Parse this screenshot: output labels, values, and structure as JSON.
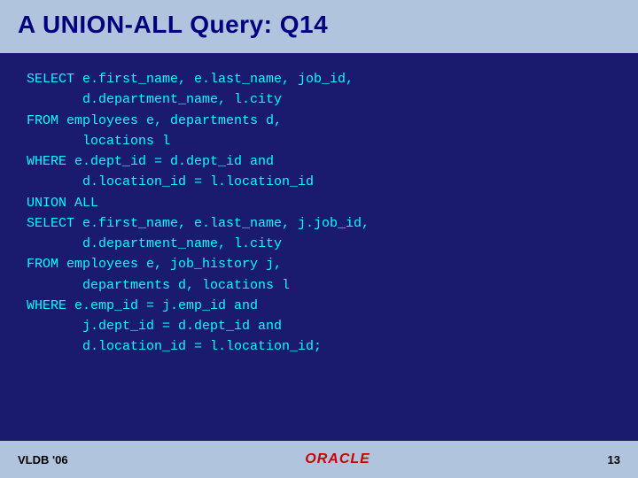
{
  "slide": {
    "title": "A UNION-ALL Query: Q14",
    "code": "SELECT e.first_name, e.last_name, job_id,\n       d.department_name, l.city\nFROM employees e, departments d,\n       locations l\nWHERE e.dept_id = d.dept_id and\n       d.location_id = l.location_id\nUNION ALL\nSELECT e.first_name, e.last_name, j.job_id,\n       d.department_name, l.city\nFROM employees e, job_history j,\n       departments d, locations l\nWHERE e.emp_id = j.emp_id and\n       j.dept_id = d.dept_id and\n       d.location_id = l.location_id;",
    "footer": {
      "left": "VLDB '06",
      "right": "13",
      "oracle_label": "ORACLE"
    }
  }
}
